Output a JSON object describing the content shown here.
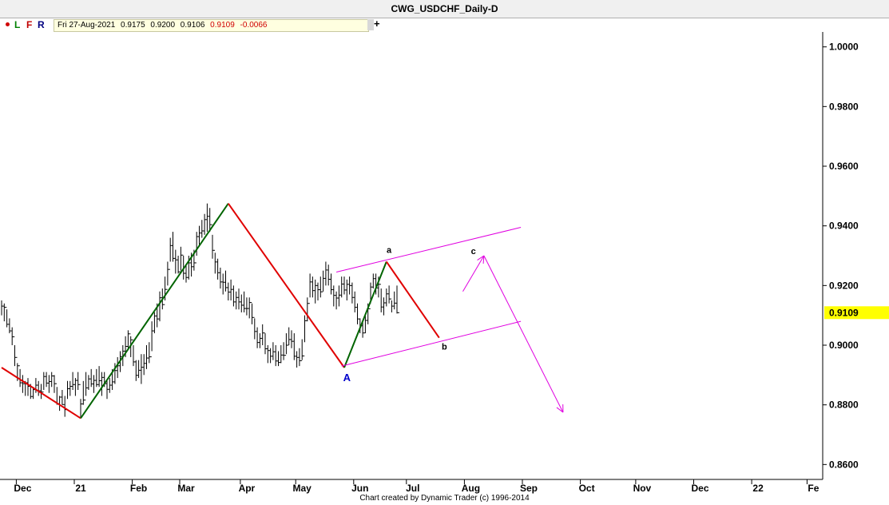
{
  "window": {
    "title": "CWG_USDCHF_Daily-D"
  },
  "toolbar": {
    "buttons": [
      "L",
      "F",
      "R"
    ],
    "info": {
      "date": "Fri 27-Aug-2021",
      "open": "0.9175",
      "high": "0.9200",
      "low": "0.9106",
      "close": "0.9109",
      "change": "-0.0066"
    },
    "add": "+"
  },
  "footer": "Chart created by Dynamic Trader  (c) 1996-2014",
  "colors": {
    "up_wave": "#006400",
    "down_wave": "#e00000",
    "channel": "#e000e0",
    "bars": "#000000",
    "price_marker": "#ffff00",
    "label_A": "#0000cc"
  },
  "chart_data": {
    "type": "ohlc",
    "ylim": [
      0.855,
      1.005
    ],
    "y_ticks": [
      "1.0000",
      "0.9800",
      "0.9600",
      "0.9400",
      "0.9200",
      "0.9000",
      "0.8800",
      "0.8600"
    ],
    "x_ticks": [
      "Dec",
      "21",
      "Feb",
      "Mar",
      "Apr",
      "May",
      "Jun",
      "Jul",
      "Aug",
      "Sep",
      "Oct",
      "Nov",
      "Dec",
      "22",
      "Fe"
    ],
    "last_price": "0.9109",
    "waves": [
      {
        "color": "down",
        "points": [
          [
            -30,
            0.8925
          ],
          [
            0,
            0.8755
          ]
        ]
      },
      {
        "color": "up",
        "points": [
          [
            0,
            0.8755
          ],
          [
            56,
            0.9475
          ]
        ]
      },
      {
        "color": "down",
        "points": [
          [
            56,
            0.9475
          ],
          [
            100,
            0.8925
          ]
        ]
      },
      {
        "color": "up",
        "points": [
          [
            100,
            0.8925
          ],
          [
            116,
            0.928
          ]
        ]
      },
      {
        "color": "down",
        "points": [
          [
            116,
            0.928
          ],
          [
            136,
            0.9025
          ]
        ]
      }
    ],
    "channel": [
      {
        "points": [
          [
            97,
            0.9245
          ],
          [
            167,
            0.9395
          ]
        ]
      },
      {
        "points": [
          [
            99,
            0.893
          ],
          [
            167,
            0.908
          ]
        ]
      }
    ],
    "projection": {
      "points": [
        [
          145,
          0.918
        ],
        [
          153,
          0.93
        ],
        [
          183,
          0.8775
        ]
      ]
    },
    "labels": [
      {
        "text": "a",
        "x": 117,
        "y": 0.931
      },
      {
        "text": "b",
        "x": 138,
        "y": 0.8985
      },
      {
        "text": "c",
        "x": 149,
        "y": 0.9305
      },
      {
        "text": "A",
        "x": 101,
        "y": 0.888
      }
    ],
    "bars": [
      [
        -30,
        0.915,
        0.91,
        0.9131
      ],
      [
        -29,
        0.914,
        0.908,
        0.9127
      ],
      [
        -28,
        0.912,
        0.906,
        0.907
      ],
      [
        -27,
        0.909,
        0.904,
        0.9048
      ],
      [
        -26,
        0.906,
        0.9,
        0.9028
      ],
      [
        -25,
        0.9,
        0.893,
        0.8959
      ],
      [
        -24,
        0.894,
        0.888,
        0.8931
      ],
      [
        -23,
        0.892,
        0.886,
        0.8874
      ],
      [
        -22,
        0.89,
        0.884,
        0.8871
      ],
      [
        -21,
        0.888,
        0.883,
        0.8874
      ],
      [
        -20,
        0.889,
        0.883,
        0.8862
      ],
      [
        -19,
        0.887,
        0.882,
        0.8828
      ],
      [
        -18,
        0.886,
        0.882,
        0.8851
      ],
      [
        -17,
        0.889,
        0.884,
        0.8866
      ],
      [
        -16,
        0.888,
        0.883,
        0.8847
      ],
      [
        -15,
        0.887,
        0.882,
        0.8843
      ],
      [
        -14,
        0.891,
        0.885,
        0.8895
      ],
      [
        -13,
        0.891,
        0.886,
        0.8873
      ],
      [
        -12,
        0.89,
        0.884,
        0.8878
      ],
      [
        -11,
        0.891,
        0.886,
        0.8897
      ],
      [
        -10,
        0.89,
        0.884,
        0.8871
      ],
      [
        -9,
        0.886,
        0.88,
        0.8804
      ],
      [
        -8,
        0.883,
        0.878,
        0.8826
      ],
      [
        -7,
        0.885,
        0.88,
        0.8801
      ],
      [
        -6,
        0.883,
        0.876,
        0.8784
      ],
      [
        -5,
        0.888,
        0.882,
        0.8854
      ],
      [
        -4,
        0.888,
        0.883,
        0.8862
      ],
      [
        -3,
        0.891,
        0.885,
        0.8868
      ],
      [
        -2,
        0.889,
        0.883,
        0.8882
      ],
      [
        -1,
        0.891,
        0.885,
        0.8868
      ],
      [
        0,
        0.882,
        0.8755,
        0.8803
      ],
      [
        1,
        0.888,
        0.88,
        0.8816
      ],
      [
        2,
        0.891,
        0.883,
        0.8857
      ],
      [
        3,
        0.89,
        0.885,
        0.8887
      ],
      [
        4,
        0.892,
        0.886,
        0.887
      ],
      [
        5,
        0.89,
        0.884,
        0.8882
      ],
      [
        6,
        0.892,
        0.886,
        0.8868
      ],
      [
        7,
        0.893,
        0.886,
        0.8881
      ],
      [
        8,
        0.891,
        0.883,
        0.8892
      ],
      [
        9,
        0.891,
        0.886,
        0.8871
      ],
      [
        10,
        0.888,
        0.882,
        0.8852
      ],
      [
        11,
        0.889,
        0.884,
        0.8866
      ],
      [
        12,
        0.892,
        0.885,
        0.8877
      ],
      [
        13,
        0.894,
        0.887,
        0.8915
      ],
      [
        14,
        0.896,
        0.889,
        0.8931
      ],
      [
        15,
        0.898,
        0.891,
        0.8962
      ],
      [
        16,
        0.9,
        0.893,
        0.898
      ],
      [
        17,
        0.903,
        0.896,
        0.8996
      ],
      [
        18,
        0.905,
        0.899,
        0.9038
      ],
      [
        19,
        0.903,
        0.896,
        0.9018
      ],
      [
        20,
        0.9,
        0.893,
        0.8944
      ],
      [
        21,
        0.895,
        0.888,
        0.8899
      ],
      [
        22,
        0.895,
        0.889,
        0.8916
      ],
      [
        23,
        0.897,
        0.887,
        0.8926
      ],
      [
        24,
        0.897,
        0.89,
        0.8939
      ],
      [
        25,
        0.9,
        0.892,
        0.8957
      ],
      [
        26,
        0.901,
        0.894,
        0.8961
      ],
      [
        27,
        0.908,
        0.898,
        0.9048
      ],
      [
        28,
        0.911,
        0.904,
        0.9098
      ],
      [
        29,
        0.914,
        0.906,
        0.9088
      ],
      [
        30,
        0.918,
        0.908,
        0.9159
      ],
      [
        31,
        0.919,
        0.912,
        0.9136
      ],
      [
        32,
        0.923,
        0.915,
        0.9187
      ],
      [
        33,
        0.928,
        0.92,
        0.9254
      ],
      [
        34,
        0.936,
        0.928,
        0.9334
      ],
      [
        35,
        0.938,
        0.928,
        0.9291
      ],
      [
        36,
        0.932,
        0.924,
        0.9286
      ],
      [
        37,
        0.93,
        0.924,
        0.9246
      ],
      [
        38,
        0.933,
        0.925,
        0.9302
      ],
      [
        39,
        0.93,
        0.922,
        0.9241
      ],
      [
        40,
        0.927,
        0.921,
        0.9227
      ],
      [
        41,
        0.93,
        0.922,
        0.9276
      ],
      [
        42,
        0.931,
        0.923,
        0.9263
      ],
      [
        43,
        0.932,
        0.925,
        0.9276
      ],
      [
        44,
        0.938,
        0.93,
        0.9364
      ],
      [
        45,
        0.94,
        0.933,
        0.9376
      ],
      [
        46,
        0.942,
        0.936,
        0.9383
      ],
      [
        47,
        0.944,
        0.937,
        0.9421
      ],
      [
        48,
        0.9475,
        0.938,
        0.9432
      ],
      [
        49,
        0.946,
        0.938,
        0.9404
      ],
      [
        50,
        0.937,
        0.929,
        0.9318
      ],
      [
        51,
        0.931,
        0.924,
        0.9279
      ],
      [
        52,
        0.929,
        0.922,
        0.9243
      ],
      [
        53,
        0.926,
        0.919,
        0.9212
      ],
      [
        54,
        0.924,
        0.917,
        0.9211
      ],
      [
        55,
        0.925,
        0.918,
        0.9193
      ],
      [
        56,
        0.921,
        0.915,
        0.9178
      ],
      [
        57,
        0.922,
        0.915,
        0.9187
      ],
      [
        58,
        0.92,
        0.913,
        0.9145
      ],
      [
        59,
        0.918,
        0.912,
        0.916
      ],
      [
        60,
        0.919,
        0.912,
        0.9145
      ],
      [
        61,
        0.917,
        0.911,
        0.9134
      ],
      [
        62,
        0.918,
        0.911,
        0.9123
      ],
      [
        63,
        0.916,
        0.91,
        0.9123
      ],
      [
        64,
        0.916,
        0.909,
        0.9143
      ],
      [
        65,
        0.914,
        0.907,
        0.9093
      ],
      [
        66,
        0.909,
        0.902,
        0.9046
      ],
      [
        67,
        0.906,
        0.899,
        0.9009
      ],
      [
        68,
        0.904,
        0.899,
        0.9023
      ],
      [
        69,
        0.907,
        0.9,
        0.9041
      ],
      [
        70,
        0.904,
        0.897,
        0.8988
      ],
      [
        71,
        0.9,
        0.894,
        0.8982
      ],
      [
        72,
        0.899,
        0.894,
        0.8963
      ],
      [
        73,
        0.901,
        0.895,
        0.8978
      ],
      [
        74,
        0.9,
        0.893,
        0.8947
      ],
      [
        75,
        0.898,
        0.893,
        0.8942
      ],
      [
        76,
        0.9,
        0.894,
        0.8967
      ],
      [
        77,
        0.901,
        0.895,
        0.8966
      ],
      [
        78,
        0.904,
        0.897,
        0.9
      ],
      [
        79,
        0.906,
        0.9,
        0.9019
      ],
      [
        80,
        0.905,
        0.899,
        0.9013
      ],
      [
        81,
        0.904,
        0.895,
        0.8963
      ],
      [
        82,
        0.898,
        0.8925,
        0.8959
      ],
      [
        83,
        0.899,
        0.893,
        0.8948
      ],
      [
        84,
        0.902,
        0.895,
        0.8964
      ],
      [
        85,
        0.91,
        0.901,
        0.9082
      ],
      [
        86,
        0.916,
        0.908,
        0.914
      ],
      [
        87,
        0.924,
        0.916,
        0.9212
      ],
      [
        88,
        0.923,
        0.916,
        0.9183
      ],
      [
        89,
        0.922,
        0.914,
        0.92
      ],
      [
        90,
        0.921,
        0.915,
        0.9186
      ],
      [
        91,
        0.923,
        0.916,
        0.9179
      ],
      [
        92,
        0.925,
        0.918,
        0.9224
      ],
      [
        93,
        0.928,
        0.92,
        0.9252
      ],
      [
        94,
        0.927,
        0.92,
        0.9221
      ],
      [
        95,
        0.924,
        0.917,
        0.9186
      ],
      [
        96,
        0.92,
        0.913,
        0.9167
      ],
      [
        97,
        0.918,
        0.912,
        0.9158
      ],
      [
        98,
        0.92,
        0.913,
        0.9168
      ],
      [
        99,
        0.923,
        0.916,
        0.9205
      ],
      [
        100,
        0.923,
        0.917,
        0.9185
      ],
      [
        101,
        0.922,
        0.915,
        0.9204
      ],
      [
        102,
        0.923,
        0.917,
        0.92
      ],
      [
        103,
        0.921,
        0.914,
        0.916
      ],
      [
        104,
        0.918,
        0.911,
        0.9127
      ],
      [
        105,
        0.914,
        0.907,
        0.9088
      ],
      [
        106,
        0.909,
        0.904,
        0.9065
      ],
      [
        107,
        0.908,
        0.9025,
        0.9041
      ],
      [
        108,
        0.91,
        0.904,
        0.9083
      ],
      [
        109,
        0.914,
        0.907,
        0.9122
      ],
      [
        110,
        0.921,
        0.914,
        0.9195
      ],
      [
        111,
        0.924,
        0.919,
        0.9223
      ],
      [
        112,
        0.924,
        0.917,
        0.9192
      ],
      [
        113,
        0.923,
        0.916,
        0.9204
      ],
      [
        114,
        0.919,
        0.911,
        0.9128
      ],
      [
        115,
        0.916,
        0.91,
        0.9142
      ],
      [
        116,
        0.919,
        0.913,
        0.9172
      ],
      [
        117,
        0.92,
        0.914,
        0.9155
      ],
      [
        118,
        0.915,
        0.911,
        0.9131
      ],
      [
        119,
        0.918,
        0.912,
        0.9141
      ],
      [
        120,
        0.92,
        0.9106,
        0.9109
      ]
    ]
  }
}
